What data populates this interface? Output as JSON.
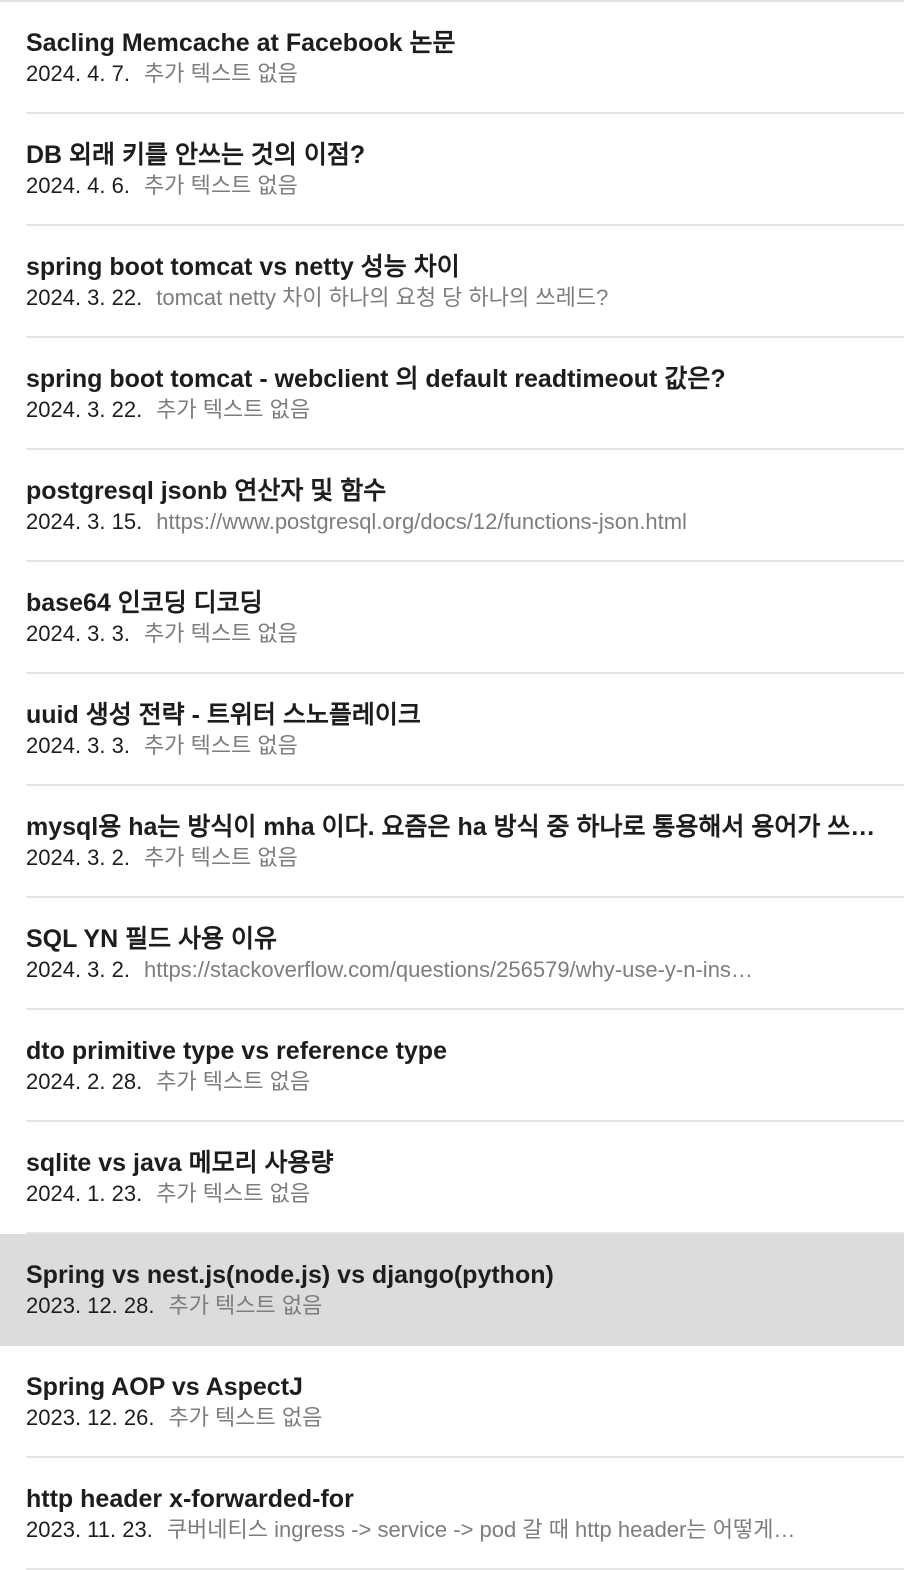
{
  "notes": [
    {
      "title": "Sacling Memcache at Facebook 논문",
      "date": "2024. 4. 7.",
      "preview": "추가 텍스트 없음",
      "selected": false
    },
    {
      "title": "DB 외래 키를 안쓰는 것의 이점?",
      "date": "2024. 4. 6.",
      "preview": "추가 텍스트 없음",
      "selected": false
    },
    {
      "title": "spring boot tomcat vs netty 성능 차이",
      "date": "2024. 3. 22.",
      "preview": "tomcat netty 차이 하나의 요청 당 하나의 쓰레드?",
      "selected": false
    },
    {
      "title": "spring boot tomcat - webclient 의 default readtimeout 값은?",
      "date": "2024. 3. 22.",
      "preview": "추가 텍스트 없음",
      "selected": false
    },
    {
      "title": "postgresql jsonb 연산자 및 함수",
      "date": "2024. 3. 15.",
      "preview": "https://www.postgresql.org/docs/12/functions-json.html",
      "selected": false
    },
    {
      "title": "base64 인코딩 디코딩",
      "date": "2024. 3. 3.",
      "preview": "추가 텍스트 없음",
      "selected": false
    },
    {
      "title": "uuid 생성 전략 - 트위터 스노플레이크",
      "date": "2024. 3. 3.",
      "preview": "추가 텍스트 없음",
      "selected": false
    },
    {
      "title": "mysql용 ha는 방식이 mha 이다. 요즘은 ha 방식 중 하나로 통용해서 용어가 쓰…",
      "date": "2024. 3. 2.",
      "preview": "추가 텍스트 없음",
      "selected": false
    },
    {
      "title": "SQL YN 필드 사용 이유",
      "date": "2024. 3. 2.",
      "preview": "https://stackoverflow.com/questions/256579/why-use-y-n-ins…",
      "selected": false
    },
    {
      "title": "dto primitive type vs reference type",
      "date": "2024. 2. 28.",
      "preview": "추가 텍스트 없음",
      "selected": false
    },
    {
      "title": "sqlite vs java 메모리 사용량",
      "date": "2024. 1. 23.",
      "preview": "추가 텍스트 없음",
      "selected": false
    },
    {
      "title": "Spring vs nest.js(node.js) vs django(python)",
      "date": "2023. 12. 28.",
      "preview": "추가 텍스트 없음",
      "selected": true
    },
    {
      "title": "Spring AOP vs AspectJ",
      "date": "2023. 12. 26.",
      "preview": "추가 텍스트 없음",
      "selected": false
    },
    {
      "title": "http header x-forwarded-for",
      "date": "2023. 11. 23.",
      "preview": "쿠버네티스 ingress -> service -> pod 갈 때 http header는 어떻게…",
      "selected": false
    }
  ]
}
